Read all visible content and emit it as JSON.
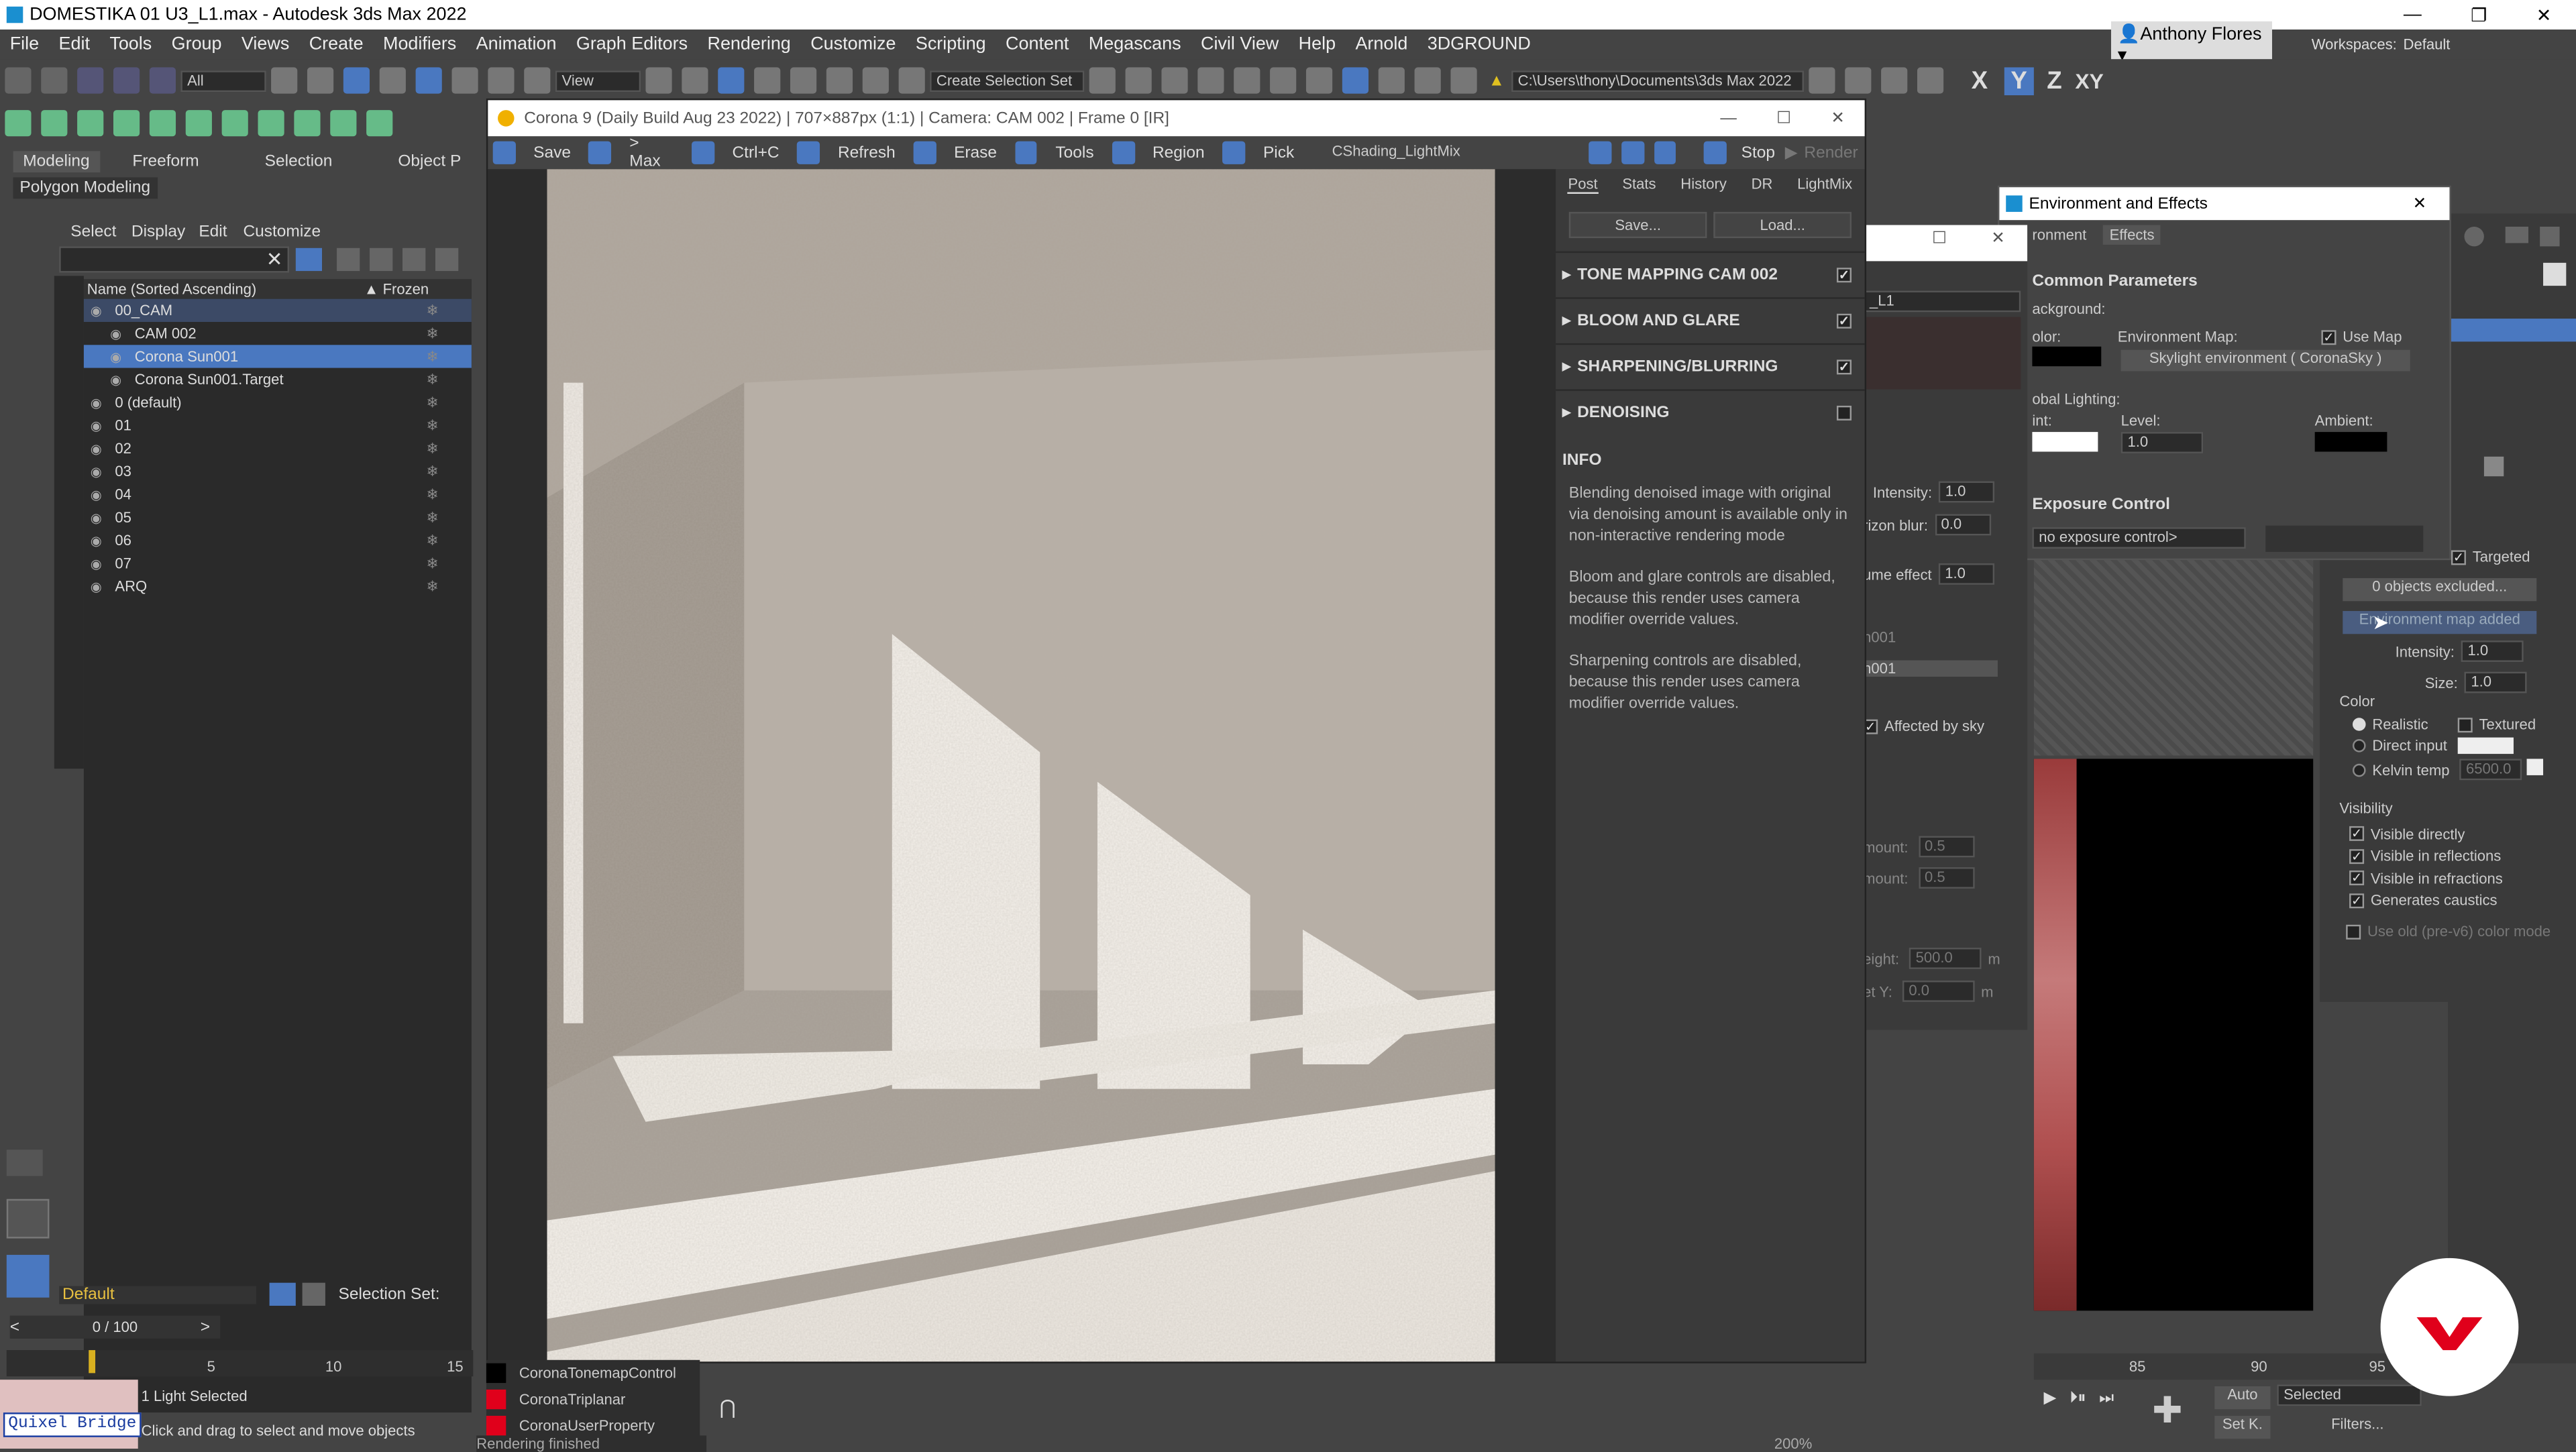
{
  "window": {
    "title": "DOMESTIKA 01 U3_L1.max - Autodesk 3ds Max 2022"
  },
  "menu": [
    "File",
    "Edit",
    "Tools",
    "Group",
    "Views",
    "Create",
    "Modifiers",
    "Animation",
    "Graph Editors",
    "Rendering",
    "Customize",
    "Scripting",
    "Content",
    "Megascans",
    "Civil View",
    "Help",
    "Arnold",
    "3DGROUND"
  ],
  "user": {
    "name": "Anthony Flores",
    "workspaces_label": "Workspaces:",
    "workspace": "Default"
  },
  "toolbar": {
    "filter": "All",
    "view": "View",
    "selection_set": "Create Selection Set",
    "path": "C:\\Users\\thony\\Documents\\3ds Max 2022",
    "axes": [
      "X",
      "Y",
      "Z",
      "XY"
    ]
  },
  "ribbon": {
    "tabs": [
      "Modeling",
      "Freeform",
      "Selection",
      "Object P"
    ],
    "sub": "Polygon Modeling"
  },
  "scene_explorer": {
    "menu": [
      "Select",
      "Display",
      "Edit",
      "Customize"
    ],
    "col_name": "Name (Sorted Ascending)",
    "col_frozen": "▲ Frozen",
    "rows": [
      {
        "label": "00_CAM",
        "indent": 0
      },
      {
        "label": "CAM 002",
        "indent": 1
      },
      {
        "label": "Corona Sun001",
        "indent": 1,
        "selected": true
      },
      {
        "label": "Corona Sun001.Target",
        "indent": 1
      },
      {
        "label": "0 (default)",
        "indent": 0
      },
      {
        "label": "01",
        "indent": 0
      },
      {
        "label": "02",
        "indent": 0
      },
      {
        "label": "03",
        "indent": 0
      },
      {
        "label": "04",
        "indent": 0
      },
      {
        "label": "05",
        "indent": 0
      },
      {
        "label": "06",
        "indent": 0
      },
      {
        "label": "07",
        "indent": 0
      },
      {
        "label": "ARQ",
        "indent": 0
      }
    ]
  },
  "bottom_left": {
    "layer": "Default",
    "selection_set": "Selection Set:",
    "time": "0 / 100",
    "ticks": [
      "5",
      "10",
      "15"
    ],
    "quixel": "Quixel Bridge",
    "status1": "1 Light Selected",
    "status2": "Click and drag to select and move objects"
  },
  "vfb": {
    "title": "Corona 9 (Daily Build Aug 23 2022) | 707×887px (1:1) | Camera: CAM 002 | Frame 0 [IR]",
    "toolbar": [
      "Save",
      "> Max",
      "Ctrl+C",
      "Refresh",
      "Erase",
      "Tools",
      "Region",
      "Pick"
    ],
    "shading": "CShading_LightMix",
    "stop": "Stop",
    "render": "Render",
    "tabs": [
      "Post",
      "Stats",
      "History",
      "DR",
      "LightMix"
    ],
    "save": "Save...",
    "load": "Load...",
    "sections": [
      {
        "label": "TONE MAPPING CAM 002",
        "checked": true
      },
      {
        "label": "BLOOM AND GLARE",
        "checked": true
      },
      {
        "label": "SHARPENING/BLURRING",
        "checked": true
      },
      {
        "label": "DENOISING",
        "checked": false
      }
    ],
    "info_header": "INFO",
    "info": [
      "Blending denoised image with original via denoising amount is available only in non-interactive rendering mode",
      "Bloom and glare controls are disabled, because this render uses camera modifier override values.",
      "Sharpening controls are disabled, because this render uses camera modifier override values."
    ],
    "statusbar": "Rendering finished"
  },
  "scripts": [
    "CoronaTonemapControl",
    "CoronaTriplanar",
    "CoronaUserProperty"
  ],
  "middle_panel": {
    "name": "_L1",
    "fields": [
      {
        "label": "Intensity:",
        "value": "1.0"
      },
      {
        "label": "rizon blur:",
        "value": "0.0"
      },
      {
        "label": "ume effect",
        "value": "1.0"
      }
    ],
    "n1": "n001",
    "n2": "n001",
    "affected": "Affected by sky",
    "amt1": {
      "label": "mount:",
      "value": "0.5"
    },
    "amt2": {
      "label": "mount:",
      "value": "0.5"
    },
    "height": {
      "label": "eight:",
      "value": "500.0",
      "unit": "m"
    },
    "sety": {
      "label": "et Y:",
      "value": "0.0",
      "unit": "m"
    }
  },
  "env": {
    "title": "Environment and Effects",
    "tabs": [
      "ronment",
      "Effects"
    ],
    "common": "Common Parameters",
    "background": "ackground:",
    "color": "olor:",
    "env_map": "Environment Map:",
    "use_map": "Use Map",
    "skylight": "Skylight environment ( CoronaSky )",
    "global": "obal Lighting:",
    "tint": "int:",
    "level": "Level:",
    "level_val": "1.0",
    "ambient": "Ambient:",
    "exposure": "Exposure Control",
    "no_exp": "no exposure control>"
  },
  "sun": {
    "targeted": "Targeted",
    "excluded": "0 objects excluded...",
    "envmap": "Environment map added",
    "intensity": {
      "label": "Intensity:",
      "value": "1.0"
    },
    "size": {
      "label": "Size:",
      "value": "1.0"
    },
    "color": "Color",
    "realistic": "Realistic",
    "textured": "Textured",
    "direct": "Direct input",
    "kelvin": "Kelvin temp",
    "kelvin_val": "6500.0",
    "visibility": "Visibility",
    "vis": [
      "Visible directly",
      "Visible in reflections",
      "Visible in refractions",
      "Generates caustics"
    ],
    "old": "Use old (pre-v6) color mode"
  },
  "bottom_right": {
    "ticks": [
      "85",
      "90",
      "95"
    ],
    "auto": "Auto",
    "selected": "Selected",
    "setk": "Set K.",
    "filters": "Filters...",
    "zoom": "200%"
  },
  "colors": {
    "accent": "#5b87c5",
    "brand": "#e0001b"
  }
}
